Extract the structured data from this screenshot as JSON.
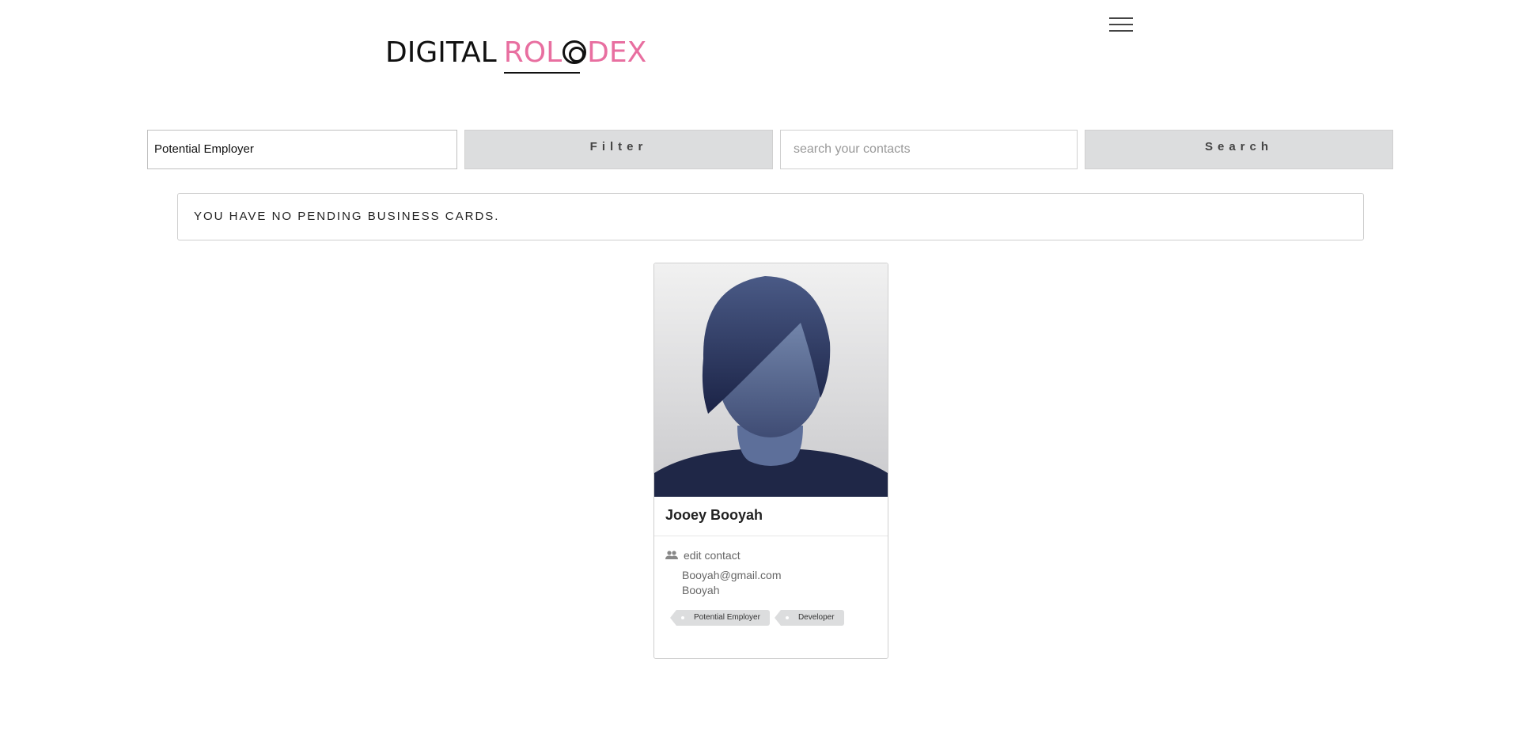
{
  "logo": {
    "part1": "DIGITAL",
    "part2_a": "ROL",
    "part2_b": "DEX"
  },
  "menu": {
    "icon": "hamburger-menu-icon"
  },
  "toolbar": {
    "filter_value": "Potential Employer",
    "filter_label": "Filter",
    "search_placeholder": "search your contacts",
    "search_label": "Search"
  },
  "notice": {
    "text": "YOU HAVE NO PENDING BUSINESS CARDS."
  },
  "contacts": [
    {
      "name": "Jooey Booyah",
      "edit_label": "edit contact",
      "email": "Booyah@gmail.com",
      "company": "Booyah",
      "tags": [
        "Potential Employer",
        "Developer"
      ]
    }
  ],
  "colors": {
    "brand_pink": "#e86fa0",
    "button_gray": "#dcddde",
    "avatar_navy": "#1f2747"
  }
}
